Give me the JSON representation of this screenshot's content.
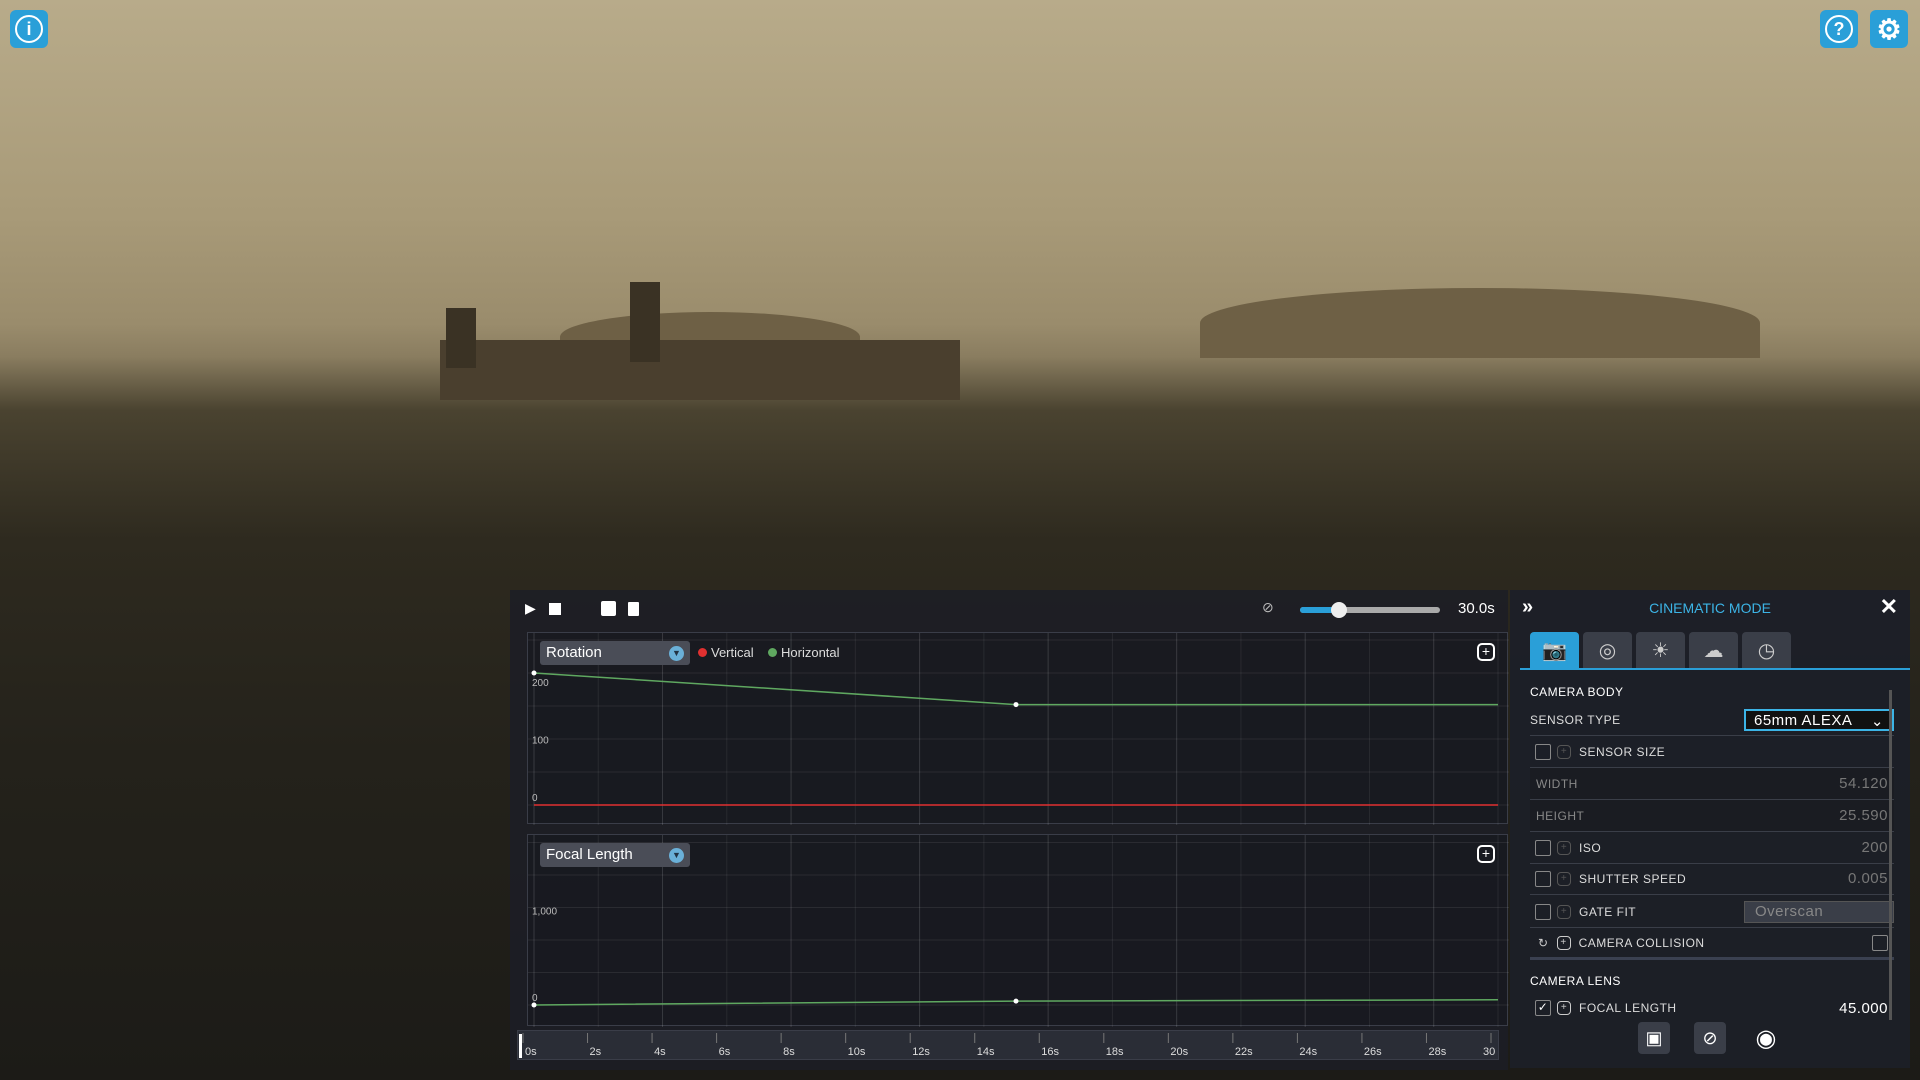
{
  "top_icons": {
    "info": "info-icon",
    "help": "help-icon",
    "settings": "gear-icon",
    "accent": "#2a9fd8"
  },
  "timeline": {
    "duration_label": "30.0s",
    "speed_slider_fraction": 0.28,
    "rotation_graph": {
      "selector": "Rotation",
      "legend": [
        {
          "name": "Vertical",
          "color": "#e03030"
        },
        {
          "name": "Horizontal",
          "color": "#5fa860"
        }
      ]
    },
    "focal_graph": {
      "selector": "Focal Length"
    },
    "time_ticks": [
      "0s",
      "2s",
      "4s",
      "6s",
      "8s",
      "10s",
      "12s",
      "14s",
      "16s",
      "18s",
      "20s",
      "22s",
      "24s",
      "26s",
      "28s",
      "30"
    ]
  },
  "chart_data": [
    {
      "type": "line",
      "title": "Rotation",
      "ylim": [
        0,
        230
      ],
      "yticks": [
        "0",
        "100",
        "200"
      ],
      "xlim": [
        0,
        30
      ],
      "series": [
        {
          "name": "Vertical",
          "color": "#e03030",
          "x": [
            0,
            30
          ],
          "y": [
            0,
            0
          ]
        },
        {
          "name": "Horizontal",
          "color": "#5fa860",
          "x": [
            0,
            15,
            30
          ],
          "y": [
            230,
            175,
            175
          ]
        }
      ]
    },
    {
      "type": "line",
      "title": "Focal Length",
      "ylim": [
        0,
        1500
      ],
      "yticks": [
        "0",
        "1,000"
      ],
      "xlim": [
        0,
        30
      ],
      "series": [
        {
          "color": "#5fa860",
          "x": [
            0,
            15,
            30
          ],
          "y": [
            0,
            45,
            60
          ]
        }
      ]
    }
  ],
  "panel": {
    "title": "CINEMATIC MODE",
    "tabs": [
      "camera-icon",
      "aperture-icon",
      "exposure-icon",
      "cloud-icon",
      "clock-icon"
    ],
    "camera_body": "CAMERA BODY",
    "sensor_type_label": "SENSOR TYPE",
    "sensor_type_value": "65mm ALEXA",
    "sensor_size": "SENSOR SIZE",
    "width_label": "WIDTH",
    "width_value": "54.120",
    "height_label": "HEIGHT",
    "height_value": "25.590",
    "iso_label": "ISO",
    "iso_value": "200",
    "shutter_label": "SHUTTER SPEED",
    "shutter_value": "0.005",
    "gate_fit_label": "GATE FIT",
    "gate_fit_value": "Overscan",
    "collision_label": "CAMERA COLLISION",
    "camera_lens": "CAMERA LENS",
    "focal_label": "FOCAL LENGTH",
    "focal_value": "45.000"
  }
}
